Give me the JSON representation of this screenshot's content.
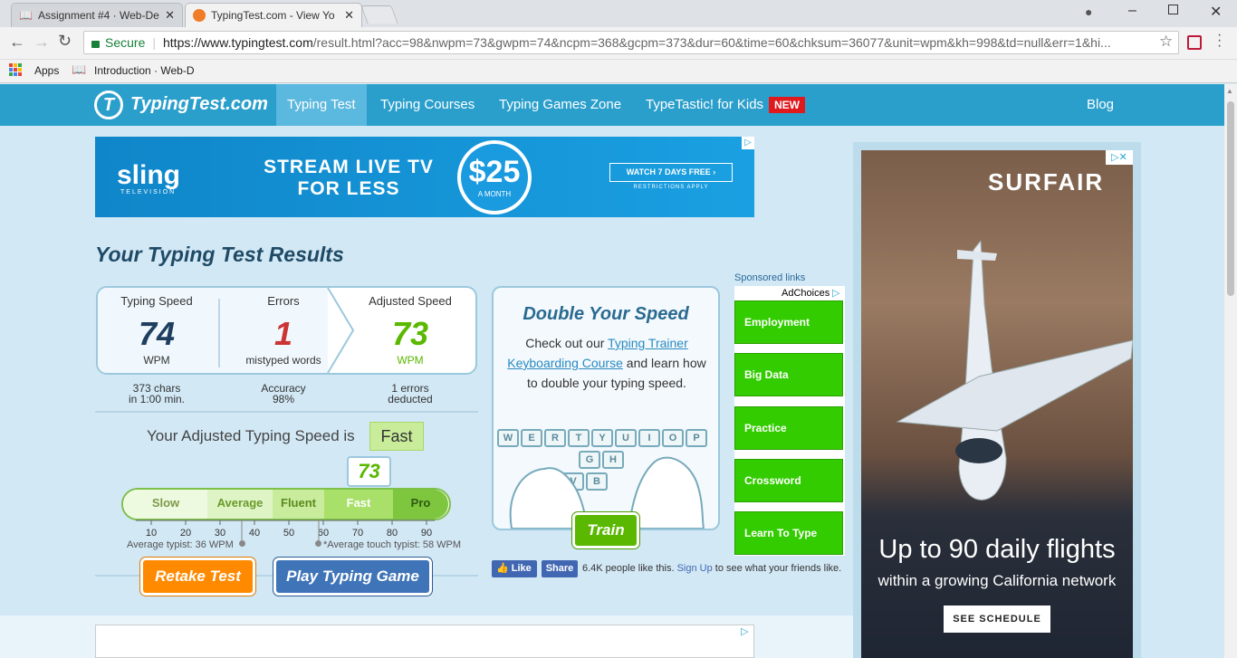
{
  "browser": {
    "tabs": [
      {
        "title": "Assignment #4 · Web-De",
        "active": false
      },
      {
        "title": "TypingTest.com - View Yo",
        "active": true
      }
    ],
    "secure_label": "Secure",
    "url_host": "https://www.typingtest.com",
    "url_path": "/result.html?acc=98&nwpm=73&gwpm=74&ncpm=368&gcpm=373&dur=60&time=60&chksum=36077&unit=wpm&kh=998&td=null&err=1&hi...",
    "bookmarks": [
      "Apps",
      "Introduction · Web-D"
    ]
  },
  "site": {
    "logo_text": "TypingTest.com",
    "nav": [
      "Typing Test",
      "Typing Courses",
      "Typing Games Zone",
      "TypeTastic! for Kids"
    ],
    "new_badge": "NEW",
    "blog": "Blog"
  },
  "banner_ad": {
    "brand": "sling",
    "brand_sub": "TELEVISION",
    "headline_1": "STREAM LIVE TV",
    "headline_2": "FOR LESS",
    "price": "$25",
    "price_sub": "A MONTH",
    "cta": "WATCH 7 DAYS FREE ›",
    "fine_print": "RESTRICTIONS APPLY"
  },
  "results": {
    "title": "Your Typing Test Results",
    "typing_speed_label": "Typing Speed",
    "typing_speed_value": "74",
    "typing_speed_unit": "WPM",
    "errors_label": "Errors",
    "errors_value": "1",
    "errors_unit": "mistyped words",
    "adjusted_label": "Adjusted Speed",
    "adjusted_value": "73",
    "adjusted_unit": "WPM",
    "chars_line1": "373 chars",
    "chars_line2": "in 1:00 min.",
    "accuracy_line1": "Accuracy",
    "accuracy_line2": "98%",
    "deducted_line1": "1 errors",
    "deducted_line2": "deducted",
    "adjusted_is": "Your Adjusted Typing Speed is",
    "rating": "Fast",
    "marker_value": "73",
    "marker_fraction": 0.79,
    "scale_segments": [
      "Slow",
      "Average",
      "Fluent",
      "Fast",
      "Pro"
    ],
    "ticks": [
      "10",
      "20",
      "30",
      "40",
      "50",
      "60",
      "70",
      "80",
      "90"
    ],
    "avg_typist": "Average typist: 36 WPM",
    "avg_touch": "*Average touch typist: 58 WPM",
    "retake": "Retake Test",
    "play": "Play Typing Game"
  },
  "promo": {
    "title": "Double Your Speed",
    "text_before": "Check out our",
    "link_text": "Typing Trainer Keyboarding Course",
    "text_after": "and learn how to double your typing speed.",
    "keys": [
      "W",
      "E",
      "R",
      "T",
      "Y",
      "U",
      "I",
      "O",
      "P",
      "G",
      "H",
      "V",
      "B"
    ],
    "train": "Train"
  },
  "facebook": {
    "like": "Like",
    "share": "Share",
    "count_text": "6.4K people like this.",
    "signup": "Sign Up",
    "signup_rest": "to see what your friends like."
  },
  "sponsored": {
    "label": "Sponsored links",
    "adchoices": "AdChoices",
    "links": [
      "Employment",
      "Big Data",
      "Practice",
      "Crossword",
      "Learn To Type"
    ]
  },
  "side_ad": {
    "brand": "SURFAIR",
    "headline": "Up to 90 daily flights",
    "sub": "within a growing California network",
    "cta": "SEE SCHEDULE"
  },
  "colors": {
    "header": "#2b9fcc",
    "navy_number": "#1f3f5f",
    "error_red": "#cc3333",
    "green": "#5ab800",
    "retake_orange": "#ff8a00",
    "play_blue": "#3f74b8"
  }
}
